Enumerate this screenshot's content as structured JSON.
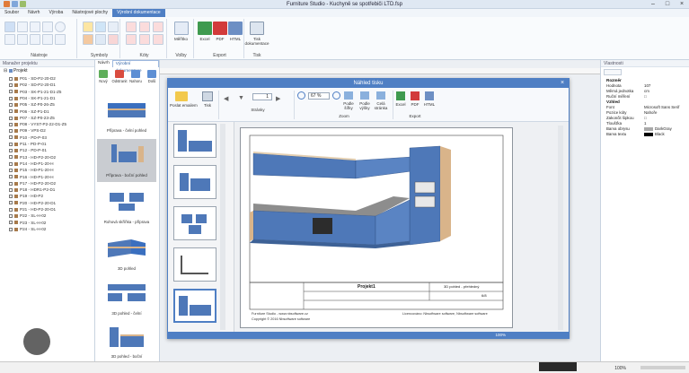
{
  "window": {
    "title": "Furniture Studio - Kuchyně se spotřebiči LTD.fsp"
  },
  "menu_tabs": [
    "Soubor",
    "Návrh",
    "Výroba",
    "Nástrojové plochy",
    "Výrobní dokumentace"
  ],
  "ribbon": {
    "groups": [
      {
        "label": "Nástroje"
      },
      {
        "label": "Symboly"
      },
      {
        "label": "Kóty"
      },
      {
        "label": "Volby",
        "items": [
          "Měřítko"
        ]
      },
      {
        "label": "Export",
        "items": [
          "Excel",
          "PDF",
          "HTML"
        ]
      },
      {
        "label": "Tisk",
        "items": [
          "Tisk dokumentace"
        ]
      }
    ]
  },
  "left_panel": {
    "title": "Manažer projektu",
    "root": "Projekt",
    "items": [
      "P01 - SD-P2-20-D2",
      "P02 - SD-P2-20-D1",
      "P03 - SK-P1-21-D1-Z5",
      "P04 - SK-P1-21-D1",
      "P05 - SZ-P0-26-Z5",
      "P06 - SZ-P1-D1",
      "P07 - SZ-P0-23-Z5",
      "P08 - VYST-P2-22-D1-Z5",
      "P09 - VPS-D2",
      "P10 - PD-P-03",
      "P11 - PD-P-01",
      "P12 - PD-P-01",
      "P13 - HD-P2-20-D2",
      "P14 - HD-P1-20-H",
      "P15 - HD-P1-20-H",
      "P16 - HD-P1-20-H",
      "P17 - HD-P2-20-D2",
      "P18 - HDR1-P2-D1",
      "P19 - HD-P2",
      "P20 - HD-P2-20-D1",
      "P21 - HD-P2-20-D1",
      "P22 - SL-H-02",
      "P23 - SL-H-02",
      "P24 - SL-H-02"
    ]
  },
  "nav_panel": {
    "tabs": [
      "Návrh",
      "Výrobní dokumentace"
    ],
    "buttons": [
      "Nový",
      "Odstranit",
      "Nahoru",
      "Dolů"
    ],
    "thumbs": [
      "Příprava - čelní pohled",
      "Příprava - boční pohled",
      "Rohová skříňka - příprava",
      "3D pohled",
      "3D pohled - čelní",
      "3D pohled - boční"
    ]
  },
  "dialog": {
    "title": "Náhled tisku",
    "groups": [
      {
        "label": "",
        "items": [
          "Poslat emailem",
          "Tisk"
        ]
      },
      {
        "label": "Stránky",
        "items": []
      },
      {
        "label": "Zoom",
        "items": [
          "Podle šířky",
          "Podle výšky",
          "Celá stránka"
        ]
      },
      {
        "label": "Export",
        "items": [
          "Excel",
          "PDF",
          "HTML"
        ]
      }
    ],
    "page_value": "1",
    "zoom_value": "67 %",
    "page_footer": {
      "project": "Projekt1",
      "meta1": "3D pohled - přehledný",
      "sheet": "6/8",
      "company": "Furniture Studio - www.nbsoftware.cz",
      "copyright": "Copyright © 2016 Nbsoftware software",
      "license": "Licencováno: Nbsoftware software, Nbsoftware software"
    },
    "status_zoom": "100%"
  },
  "right_panel": {
    "title": "Vlastnosti",
    "sections": [
      {
        "title": "Rozměr",
        "rows": [
          [
            "Hodnota",
            "107"
          ],
          [
            "Měrná jednotka",
            "cm"
          ],
          [
            "Ruční měření",
            "□"
          ]
        ]
      },
      {
        "title": "Vzhled",
        "rows": [
          [
            "Font",
            "Microsoft Sans Serif"
          ],
          [
            "Pozice kóty",
            "Nahoře"
          ],
          [
            "Zakončit šipkou",
            "□"
          ],
          [
            "Tloušťka",
            "1"
          ],
          [
            "Barva obrysu",
            "DarkGray"
          ],
          [
            "Barva textu",
            "Black"
          ]
        ]
      }
    ]
  },
  "status": {
    "zoom": "100%"
  },
  "colors": {
    "accent": "#4f7fc4",
    "cabinet_blue": "#4e78b8",
    "wood": "#d9b48a",
    "dark": "#2a2a2a"
  }
}
